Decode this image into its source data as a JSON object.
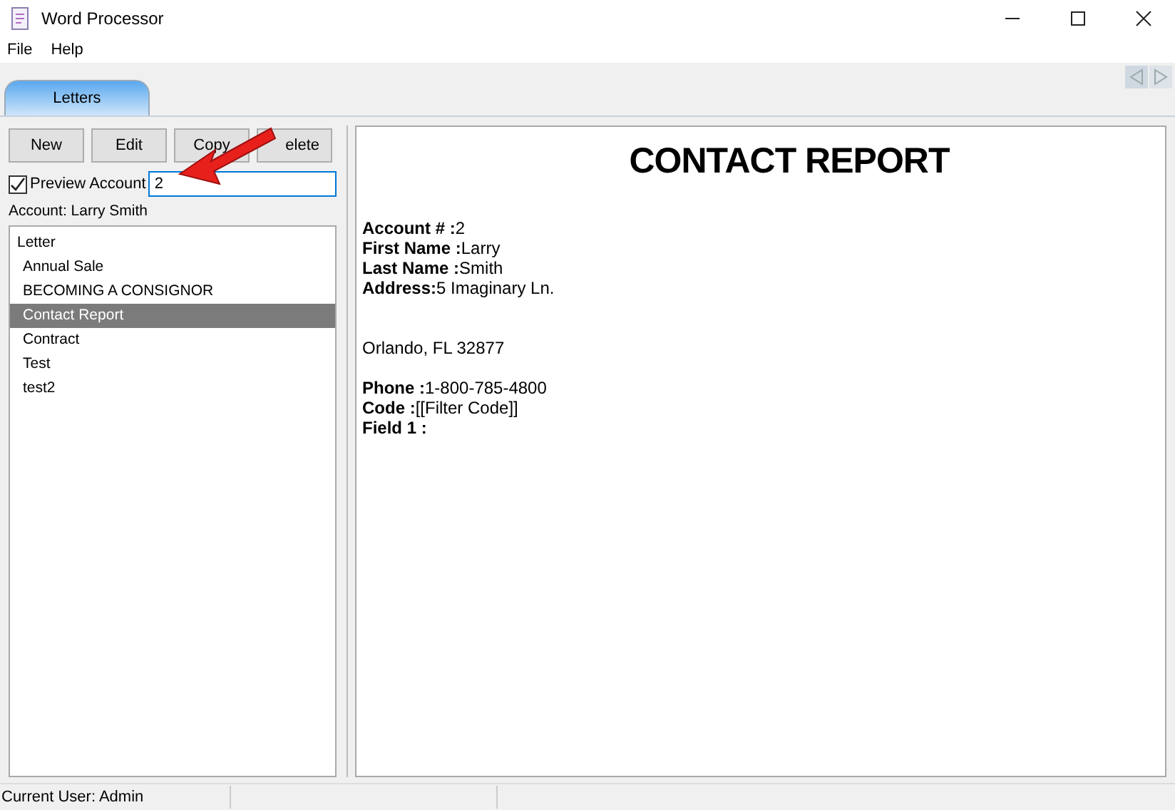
{
  "window": {
    "title": "Word Processor"
  },
  "menu": [
    "File",
    "Help"
  ],
  "tabs": [
    {
      "label": "Letters",
      "selected": true
    }
  ],
  "buttons": [
    "New",
    "Edit",
    "Copy",
    "elete"
  ],
  "preview": {
    "label": "Preview Account",
    "checked": true,
    "value": "2"
  },
  "account_label": "Account:  Larry Smith",
  "tree": {
    "label": "Letter",
    "children": [
      {
        "label": "Annual Sale",
        "selected": false
      },
      {
        "label": "BECOMING A CONSIGNOR",
        "selected": false
      },
      {
        "label": "Contact Report",
        "selected": true
      },
      {
        "label": "Contract",
        "selected": false
      },
      {
        "label": "Test",
        "selected": false
      },
      {
        "label": "test2",
        "selected": false
      }
    ]
  },
  "document": {
    "title": "CONTACT REPORT",
    "lines": [
      {
        "kind": "text",
        "text": "**Account # :**2"
      },
      {
        "kind": "text",
        "text": "**First Name :**Larry"
      },
      {
        "kind": "text",
        "text": "**Last Name :**Smith"
      },
      {
        "kind": "text",
        "text": "**Address:**5 Imaginary Ln."
      },
      {
        "kind": "blank"
      },
      {
        "kind": "blank"
      },
      {
        "kind": "text",
        "text": "Orlando, FL  32877"
      },
      {
        "kind": "blank"
      },
      {
        "kind": "text",
        "text": "**Phone :**1-800-785-4800"
      },
      {
        "kind": "text",
        "text": "**Code :**[[Filter Code]]"
      },
      {
        "kind": "text",
        "text": "**Field 1 :**"
      }
    ]
  },
  "status_bar": {
    "text": "Current User: Admin"
  }
}
